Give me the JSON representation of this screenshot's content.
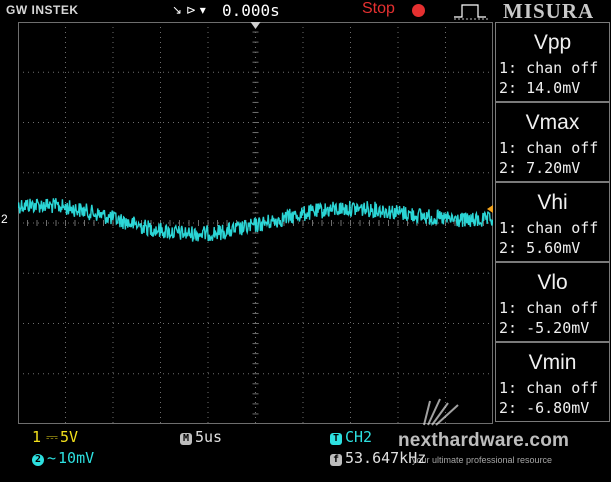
{
  "header": {
    "brand": "GW INSTEK",
    "trigger_icon": "↘ ⊳ ▾",
    "timebase_offset": "0.000s",
    "run_status": "Stop",
    "overlay_title": "MISURA"
  },
  "measurements": [
    {
      "title": "Vpp",
      "ch1": "1: chan off",
      "ch2": "2: 14.0mV"
    },
    {
      "title": "Vmax",
      "ch1": "1: chan off",
      "ch2": "2: 7.20mV"
    },
    {
      "title": "Vhi",
      "ch1": "1: chan off",
      "ch2": "2: 5.60mV"
    },
    {
      "title": "Vlo",
      "ch1": "1: chan off",
      "ch2": "2: -5.20mV"
    },
    {
      "title": "Vmin",
      "ch1": "1: chan off",
      "ch2": "2: -6.80mV"
    }
  ],
  "status_bar": {
    "ch1_badge": "1",
    "ch1_coupling": "⎓",
    "ch1_scale": "5V",
    "ch2_badge": "2",
    "ch2_coupling": "~",
    "ch2_scale": "10mV",
    "timebase_badge": "M",
    "timebase": "5us",
    "trigger_badge": "T",
    "trigger_source": "CH2",
    "freq_badge": "f",
    "frequency": "53.647kHz"
  },
  "channel_marker": "2",
  "watermark": {
    "site": "nexthardware.com",
    "tagline": "your ultimate professional resource"
  },
  "colors": {
    "ch1": "#f2e01c",
    "ch2": "#2de0e0",
    "stop": "#e53030",
    "grid": "#6e6e6e",
    "panel_border": "#7a7a7a"
  }
}
